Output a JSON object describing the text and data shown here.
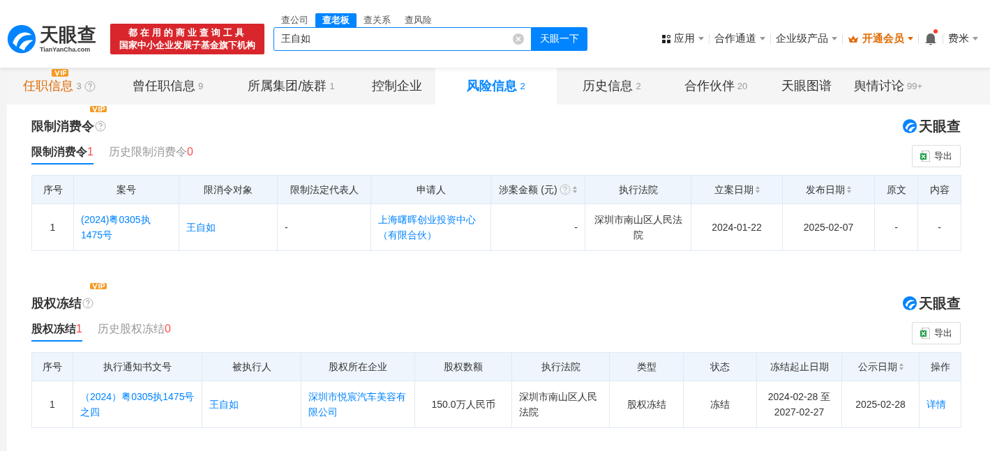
{
  "header": {
    "logo": {
      "name": "天眼查",
      "domain": "TianYanCha.com"
    },
    "slogan": [
      "都在用的商业查询工具",
      "国家中小企业发展子基金旗下机构"
    ],
    "search_tabs": [
      {
        "label": "查公司",
        "selected": false
      },
      {
        "label": "查老板",
        "selected": true
      },
      {
        "label": "查关系",
        "selected": false
      },
      {
        "label": "查风险",
        "selected": false
      }
    ],
    "search": {
      "value": "王自如",
      "button": "天眼一下"
    },
    "nav": [
      {
        "kind": "apps",
        "label": "应用"
      },
      {
        "kind": "menu",
        "label": "合作通道"
      },
      {
        "kind": "menu",
        "label": "企业级产品"
      },
      {
        "kind": "vip",
        "label": "开通会员"
      },
      {
        "kind": "bell",
        "unread": true
      },
      {
        "kind": "user",
        "label": "费米"
      }
    ]
  },
  "tabs": [
    {
      "label": "任职信息",
      "count": "3",
      "selected": false,
      "vip": true,
      "help": true
    },
    {
      "label": "曾任职信息",
      "count": "9",
      "selected": false,
      "vip": false,
      "help": false
    },
    {
      "label": "所属集团/族群",
      "count": "1",
      "selected": false,
      "vip": false,
      "help": false
    },
    {
      "label": "控制企业",
      "selected": false,
      "vip": false,
      "help": false
    },
    {
      "label": "风险信息",
      "count": "2",
      "selected": true,
      "vip": false,
      "help": false
    },
    {
      "label": "历史信息",
      "count": "2",
      "selected": false,
      "vip": false,
      "help": false
    },
    {
      "label": "合作伙伴",
      "count": "20",
      "selected": false,
      "vip": false,
      "help": false
    },
    {
      "label": "天眼图谱",
      "selected": false,
      "vip": false,
      "help": false
    },
    {
      "label": "舆情讨论",
      "count": "99+",
      "selected": false,
      "vip": false,
      "help": false
    }
  ],
  "sections": [
    {
      "title": "限制消费令",
      "vip": true,
      "brand": "天眼查",
      "subtabs": [
        {
          "label": "限制消费令",
          "count": "1",
          "selected": true
        },
        {
          "label": "历史限制消费令",
          "count": "0",
          "selected": false
        }
      ],
      "export": "导出",
      "columns": [
        {
          "label": "序号"
        },
        {
          "label": "案号"
        },
        {
          "label": "限消令对象"
        },
        {
          "label": "限制法定代表人"
        },
        {
          "label": "申请人"
        },
        {
          "label": "涉案金额 (元)",
          "help": true,
          "sortable": true
        },
        {
          "label": "执行法院"
        },
        {
          "label": "立案日期",
          "sortable": true
        },
        {
          "label": "发布日期",
          "sortable": true
        },
        {
          "label": "原文"
        },
        {
          "label": "内容"
        }
      ],
      "rows": [
        [
          {
            "text": "1"
          },
          {
            "text": "(2024)粤0305执1475号",
            "link": true
          },
          {
            "text": "王自如",
            "link": true
          },
          {
            "text": "-"
          },
          {
            "text": "上海曙晖创业投资中心（有限合伙）",
            "link": true
          },
          {
            "text": "-"
          },
          {
            "text": "深圳市南山区人民法院"
          },
          {
            "text": "2024-01-22"
          },
          {
            "text": "2025-02-07"
          },
          {
            "text": "-"
          },
          {
            "text": "-"
          }
        ]
      ]
    },
    {
      "title": "股权冻结",
      "vip": true,
      "brand": "天眼查",
      "subtabs": [
        {
          "label": "股权冻结",
          "count": "1",
          "selected": true
        },
        {
          "label": "历史股权冻结",
          "count": "0",
          "selected": false
        }
      ],
      "export": "导出",
      "columns": [
        {
          "label": "序号"
        },
        {
          "label": "执行通知书文号"
        },
        {
          "label": "被执行人"
        },
        {
          "label": "股权所在企业"
        },
        {
          "label": "股权数额"
        },
        {
          "label": "执行法院"
        },
        {
          "label": "类型"
        },
        {
          "label": "状态"
        },
        {
          "label": "冻结起止日期"
        },
        {
          "label": "公示日期",
          "sortable": true
        },
        {
          "label": "操作"
        }
      ],
      "rows": [
        [
          {
            "text": "1"
          },
          {
            "text": "（2024）粤0305执1475号之四",
            "link": true
          },
          {
            "text": "王自如",
            "link": true
          },
          {
            "text": "深圳市悦宸汽车美容有限公司",
            "link": true
          },
          {
            "text": "150.0万人民币"
          },
          {
            "text": "深圳市南山区人民法院"
          },
          {
            "text": "股权冻结"
          },
          {
            "text": "冻结"
          },
          {
            "text": "2024-02-28 至 2027-02-27"
          },
          {
            "text": "2025-02-28"
          },
          {
            "text": "详情",
            "link": true
          }
        ]
      ]
    }
  ]
}
